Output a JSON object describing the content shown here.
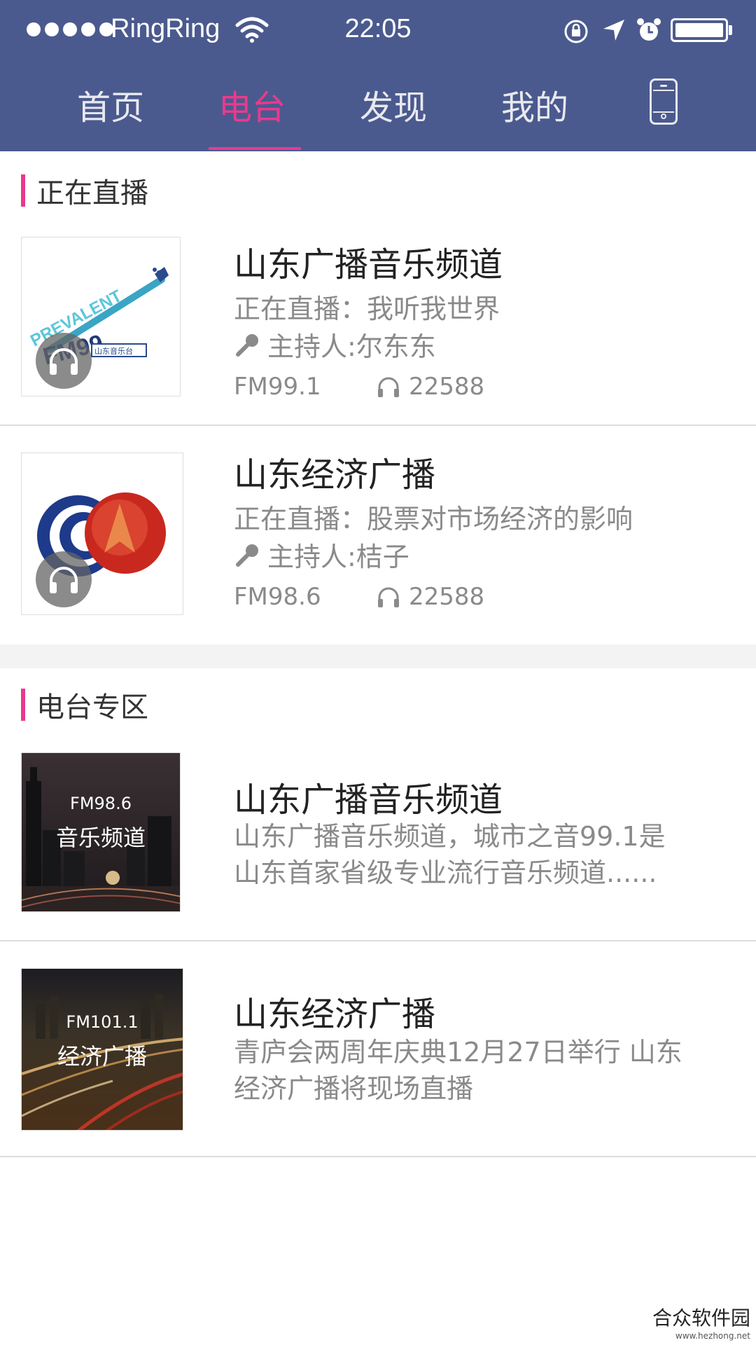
{
  "status_bar": {
    "carrier": "RingRing",
    "time": "22:05",
    "icons": [
      "signal-dots-icon",
      "wifi-icon",
      "rotation-lock-icon",
      "location-icon",
      "alarm-icon",
      "battery-icon"
    ]
  },
  "nav": {
    "tabs": [
      {
        "label": "首页"
      },
      {
        "label": "电台",
        "active": true
      },
      {
        "label": "发现"
      },
      {
        "label": "我的"
      }
    ],
    "device_icon": "phone-icon",
    "accent_color": "#e93a8d",
    "bar_color": "#4b5a8e"
  },
  "live": {
    "heading": "正在直播",
    "items": [
      {
        "title": "山东广播音乐频道",
        "now_playing": "正在直播：我听我世界",
        "host": "主持人:尔东东",
        "frequency": "FM99.1",
        "listeners": "22588",
        "logo_text": "PREVALENT FM99.1",
        "logo_sub": "山东音乐台"
      },
      {
        "title": "山东经济广播",
        "now_playing": "正在直播：股票对市场经济的影响",
        "host": "主持人:桔子",
        "frequency": "FM98.6",
        "listeners": "22588"
      }
    ]
  },
  "zone": {
    "heading": "电台专区",
    "items": [
      {
        "title": "山东广播音乐频道",
        "desc_line1": "山东广播音乐频道，城市之音99.1是",
        "desc_line2": "山东首家省级专业流行音乐频道......",
        "thumb_freq": "FM98.6",
        "thumb_name": "音乐频道"
      },
      {
        "title": "山东经济广播",
        "desc_line1": "青庐会两周年庆典12月27日举行 山东",
        "desc_line2": "经济广播将现场直播",
        "thumb_freq": "FM101.1",
        "thumb_name": "经济广播"
      }
    ]
  },
  "watermark": {
    "name": "合众软件园",
    "url": "www.hezhong.net"
  }
}
